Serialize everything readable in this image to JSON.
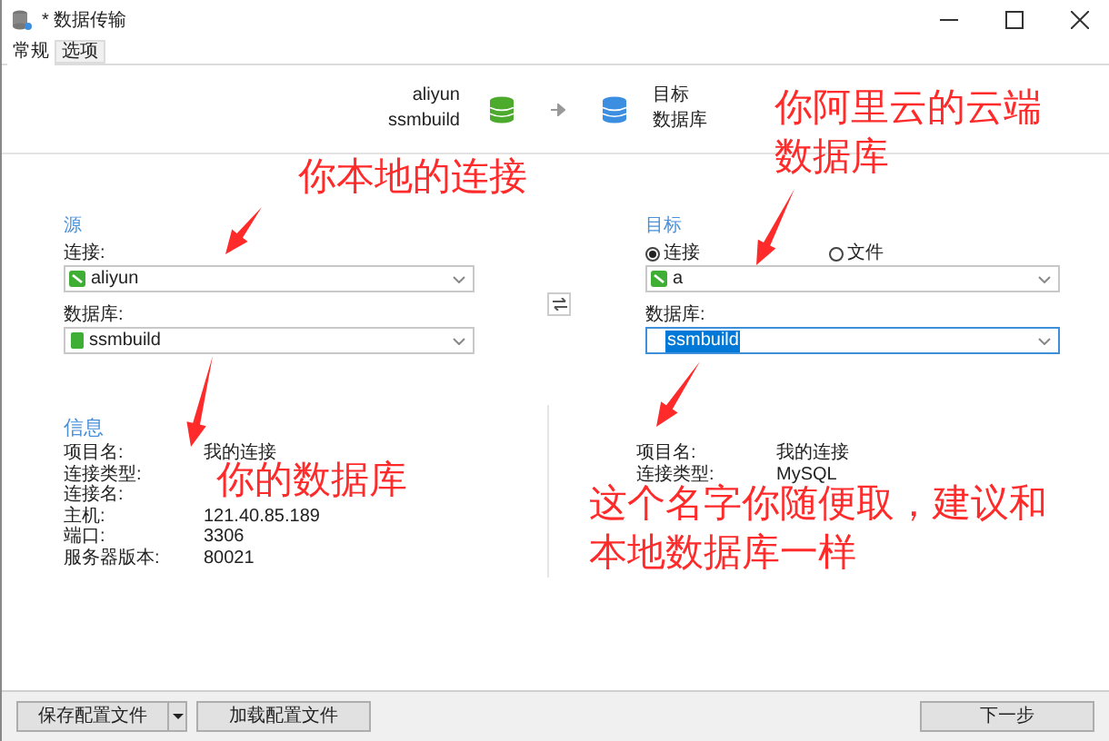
{
  "window": {
    "title": "* 数据传输"
  },
  "tabs": [
    {
      "label": "常规",
      "selected": true
    },
    {
      "label": "选项",
      "selected": false
    }
  ],
  "header": {
    "source_connection": "aliyun",
    "source_database": "ssmbuild",
    "target_line_1": "目标",
    "target_line_2": "数据库"
  },
  "source": {
    "title": "源",
    "connection_label": "连接:",
    "connection": "aliyun",
    "database_label": "数据库:",
    "database": "ssmbuild"
  },
  "target": {
    "title": "目标",
    "radios": [
      {
        "label": "连接",
        "selected": true
      },
      {
        "label": "文件",
        "selected": false
      }
    ],
    "connection": "a",
    "database_label": "数据库:",
    "database": "ssmbuild",
    "database_text_selected": true
  },
  "info_left": {
    "title": "信息",
    "rows": [
      {
        "label": "项目名:",
        "value": "我的连接"
      },
      {
        "label": "连接类型:"
      },
      {
        "label": "连接名:"
      },
      {
        "label": "主机:",
        "value": "121.40.85.189"
      },
      {
        "label": "端口:",
        "value": "3306"
      },
      {
        "label": "服务器版本:",
        "value": "80021"
      }
    ]
  },
  "info_right": {
    "rows": [
      {
        "label": "项目名:",
        "value": "我的连接"
      },
      {
        "label": "连接类型:",
        "value": "MySQL"
      }
    ]
  },
  "annotations": [
    {
      "lines": [
        "你本地的连接"
      ]
    },
    {
      "lines": [
        "你阿里云的云端",
        "数据库"
      ]
    },
    {
      "lines": [
        "你的数据库"
      ]
    },
    {
      "lines": [
        "这个名字你随便取，建议和",
        "本地数据库一样"
      ]
    }
  ],
  "buttons": [
    {
      "label": "保存配置文件",
      "kind": "split"
    },
    {
      "label": "加载配置文件",
      "kind": "plain"
    },
    {
      "label": "下一步",
      "kind": "plain"
    }
  ]
}
